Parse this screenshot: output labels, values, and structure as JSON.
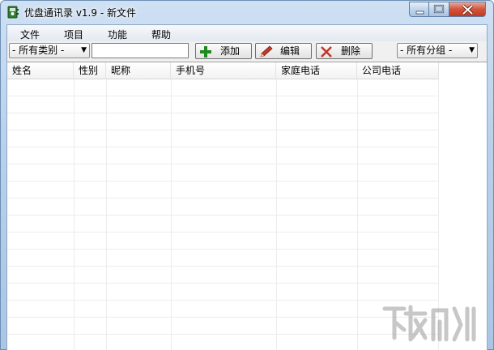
{
  "window": {
    "title": "优盘通讯录 v1.9 - 新文件",
    "controls": [
      "minimize-icon",
      "maximize-icon",
      "close-icon"
    ]
  },
  "menu": {
    "items": [
      "文件",
      "项目",
      "功能",
      "帮助"
    ]
  },
  "toolbar": {
    "category_select": "- 所有类别 -",
    "search_value": "",
    "add_label": "添加",
    "edit_label": "编辑",
    "delete_label": "删除",
    "group_select": "- 所有分组 -",
    "icons": {
      "add": "plus-icon",
      "edit": "pencil-icon",
      "delete": "x-icon"
    },
    "colors": {
      "add": "#1f8a1f",
      "edit": "#c0392b",
      "delete": "#c0392b"
    }
  },
  "table": {
    "columns": [
      "姓名",
      "性别",
      "昵称",
      "手机号",
      "家庭电话",
      "公司电话"
    ],
    "rows": []
  }
}
